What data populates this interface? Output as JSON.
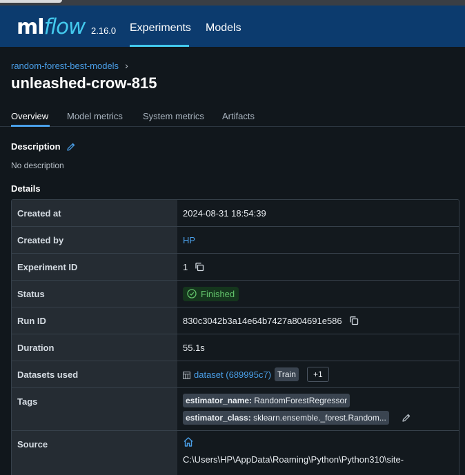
{
  "header": {
    "logo_ml": "ml",
    "logo_flow": "flow",
    "version": "2.16.0",
    "nav": [
      {
        "label": "Experiments",
        "active": true
      },
      {
        "label": "Models",
        "active": false
      }
    ],
    "colors": {
      "bar": "#0c3b6e",
      "accent": "#43c9ed"
    }
  },
  "breadcrumb": {
    "experiment": "random-forest-best-models",
    "separator": "›"
  },
  "run_name": "unleashed-crow-815",
  "tabs": [
    "Overview",
    "Model metrics",
    "System metrics",
    "Artifacts"
  ],
  "active_tab": "Overview",
  "description": {
    "label": "Description",
    "text": "No description",
    "edit_icon": "pencil-icon"
  },
  "details": {
    "label": "Details",
    "created_at": {
      "key": "Created at",
      "value": "2024-08-31 18:54:39"
    },
    "created_by": {
      "key": "Created by",
      "value": "HP"
    },
    "experiment_id": {
      "key": "Experiment ID",
      "value": "1"
    },
    "status": {
      "key": "Status",
      "value": "Finished",
      "color": "#63c46c"
    },
    "run_id": {
      "key": "Run ID",
      "value": "830c3042b3a14e64b7427a804691e586"
    },
    "duration": {
      "key": "Duration",
      "value": "55.1s"
    },
    "datasets": {
      "key": "Datasets used",
      "dataset": "dataset (689995c7)",
      "context": "Train",
      "more": "+1"
    },
    "tags": {
      "key": "Tags",
      "items": [
        {
          "name": "estimator_name:",
          "value": "RandomForestRegressor"
        },
        {
          "name": "estimator_class:",
          "value": "sklearn.ensemble._forest.Random..."
        }
      ]
    },
    "source": {
      "key": "Source",
      "path": "C:\\Users\\HP\\AppData\\Roaming\\Python\\Python310\\site-"
    }
  }
}
